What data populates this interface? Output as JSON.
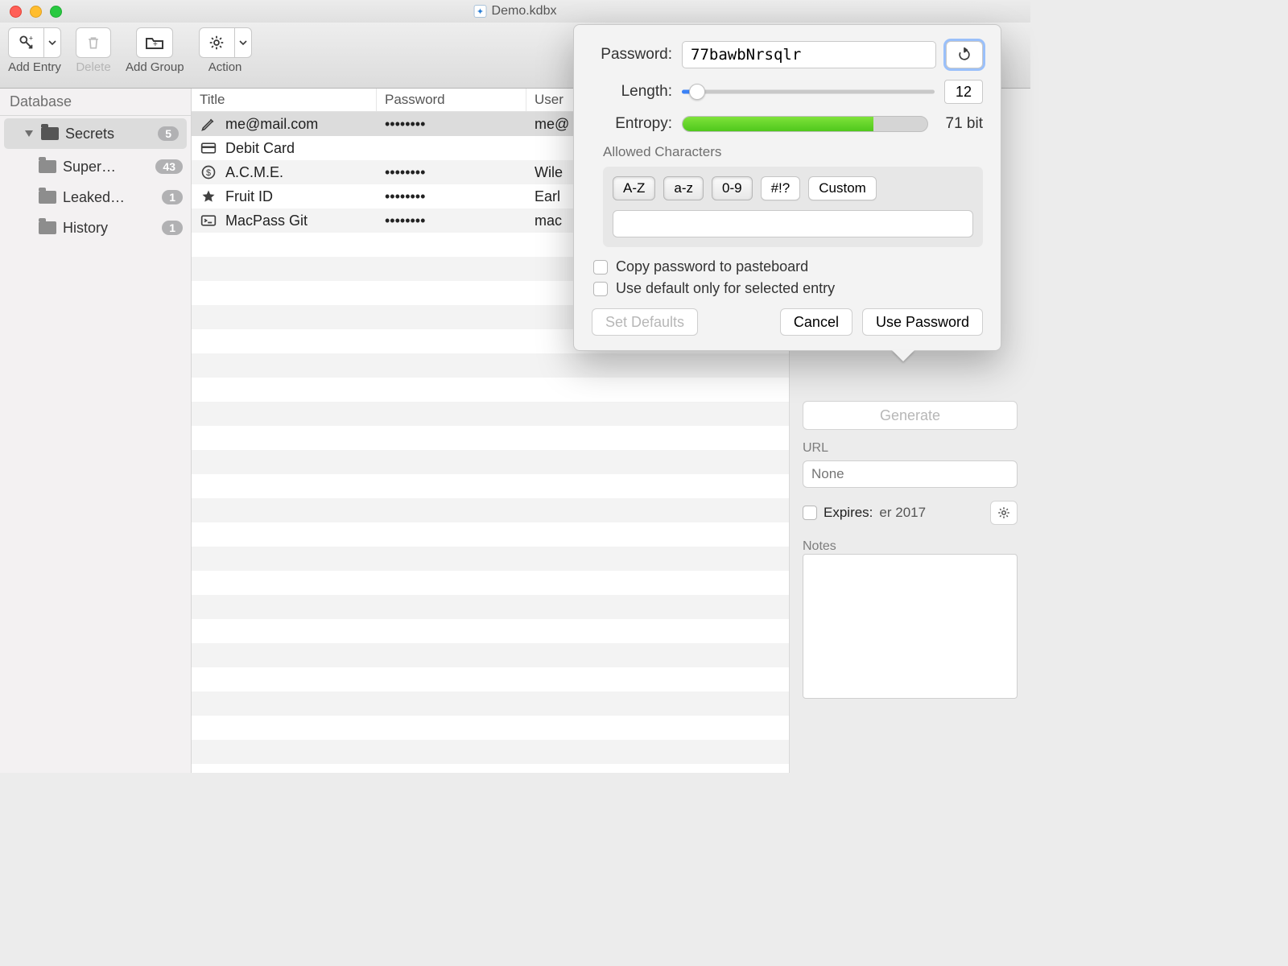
{
  "window": {
    "title": "Demo.kdbx"
  },
  "toolbar": {
    "add_entry": "Add Entry",
    "delete": "Delete",
    "add_group": "Add Group",
    "action": "Action"
  },
  "sidebar": {
    "header": "Database",
    "items": [
      {
        "label": "Secrets",
        "count": "5",
        "selected": true,
        "expandable": true
      },
      {
        "label": "Super…",
        "count": "43"
      },
      {
        "label": "Leaked…",
        "count": "1"
      },
      {
        "label": "History",
        "count": "1"
      }
    ]
  },
  "columns": {
    "title": "Title",
    "password": "Password",
    "username": "User"
  },
  "entries": [
    {
      "icon": "pen",
      "title": "me@mail.com",
      "password": "••••••••",
      "username": "me@",
      "selected": true
    },
    {
      "icon": "card",
      "title": "Debit Card",
      "password": "",
      "username": ""
    },
    {
      "icon": "dollar",
      "title": "A.C.M.E.",
      "password": "••••••••",
      "username": "Wile"
    },
    {
      "icon": "star",
      "title": "Fruit ID",
      "password": "••••••••",
      "username": "Earl"
    },
    {
      "icon": "term",
      "title": "MacPass Git",
      "password": "••••••••",
      "username": "mac"
    }
  ],
  "generator": {
    "password_label": "Password:",
    "password_value": "77bawbNrsqlr",
    "length_label": "Length:",
    "length_value": "12",
    "entropy_label": "Entropy:",
    "entropy_value": "71 bit",
    "allowed_label": "Allowed Characters",
    "seg": {
      "az_upper": "A-Z",
      "az_lower": "a-z",
      "digits": "0-9",
      "symbols": "#!?",
      "custom": "Custom"
    },
    "copy_label": "Copy password to pasteboard",
    "default_label": "Use default only for selected entry",
    "set_defaults": "Set Defaults",
    "cancel": "Cancel",
    "use_password": "Use Password"
  },
  "detail": {
    "generate": "Generate",
    "url_label": "URL",
    "url_placeholder": "None",
    "expires_label": "Expires:",
    "expires_value": "er 2017",
    "notes_label": "Notes"
  }
}
